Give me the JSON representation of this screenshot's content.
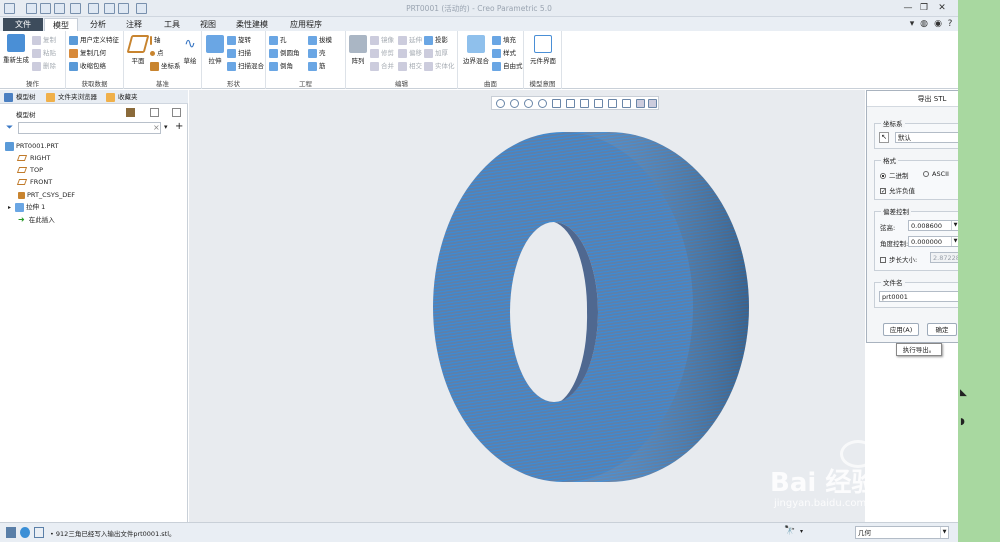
{
  "window": {
    "title": "PRT0001 (活动的) - Creo Parametric 5.0"
  },
  "ribbon_tabs": [
    {
      "label": "文件"
    },
    {
      "label": "模型"
    },
    {
      "label": "分析"
    },
    {
      "label": "注释"
    },
    {
      "label": "工具"
    },
    {
      "label": "视图"
    },
    {
      "label": "柔性建模"
    },
    {
      "label": "应用程序"
    }
  ],
  "ribbon": {
    "ops": {
      "regen": "重新生成",
      "copy": "复制",
      "paste": "粘贴",
      "delete": "删除",
      "label": "操作"
    },
    "data": {
      "udf": "用户定义特征",
      "copygeom": "复制几何",
      "shrink": "收缩包络",
      "label": "获取数据"
    },
    "datum": {
      "plane": "平面",
      "axis": "轴",
      "point": "点",
      "csys": "坐标系",
      "sketch": "草绘",
      "label": "基准"
    },
    "shape": {
      "extrude": "拉伸",
      "revolve": "旋转",
      "sweep": "扫描",
      "blend": "扫描混合",
      "label": "形状"
    },
    "eng": {
      "hole": "孔",
      "round": "倒圆角",
      "chamfer": "倒角",
      "draft": "拔模",
      "shell": "壳",
      "rib": "筋",
      "label": "工程"
    },
    "edit": {
      "pattern": "阵列",
      "mirror": "镜像",
      "trim": "修剪",
      "merge": "合并",
      "extend": "延伸",
      "offset": "偏移",
      "intersect": "相交",
      "project": "投影",
      "thicken": "加厚",
      "solidify": "实体化",
      "label": "编辑"
    },
    "surf": {
      "boundary": "边界混合",
      "fill": "填充",
      "style": "样式",
      "freeform": "自由式",
      "label": "曲面"
    },
    "intent": {
      "element": "元件界面",
      "label": "模型意图"
    }
  },
  "left_tabs": {
    "tree": "模型树",
    "browser": "文件夹浏览器",
    "fav": "收藏夹"
  },
  "tree": {
    "header": "模型树",
    "nodes": [
      {
        "label": "PRT0001.PRT"
      },
      {
        "label": "RIGHT"
      },
      {
        "label": "TOP"
      },
      {
        "label": "FRONT"
      },
      {
        "label": "PRT_CSYS_DEF"
      },
      {
        "label": "拉伸 1"
      },
      {
        "label": "在此插入"
      }
    ]
  },
  "dialog": {
    "title": "导出 STL",
    "csys_legend": "坐标系",
    "csys_value": "默认",
    "format_legend": "格式",
    "binary": "二进制",
    "ascii": "ASCII",
    "allow_neg": "允许负值",
    "deviation_legend": "偏差控制",
    "chord_label": "弦高:",
    "chord_value": "0.008600",
    "angle_label": "角度控制:",
    "angle_value": "0.000000",
    "step_label": "步长大小:",
    "step_value": "2.872281",
    "filename_legend": "文件名",
    "filename_value": "prt0001",
    "apply": "应用(A)",
    "ok": "确定",
    "close": "关闭"
  },
  "tooltip": "执行导出。",
  "status": {
    "message": "912三角已经写入输出文件prt0001.stl。",
    "filter": "几何"
  },
  "watermark": {
    "brand": "Bai 经验",
    "url": "jingyan.baidu.com"
  },
  "colors": {
    "mesh": "#2f8fe6",
    "file_tab": "#3d4c5c",
    "side": "#a8d8a0"
  }
}
